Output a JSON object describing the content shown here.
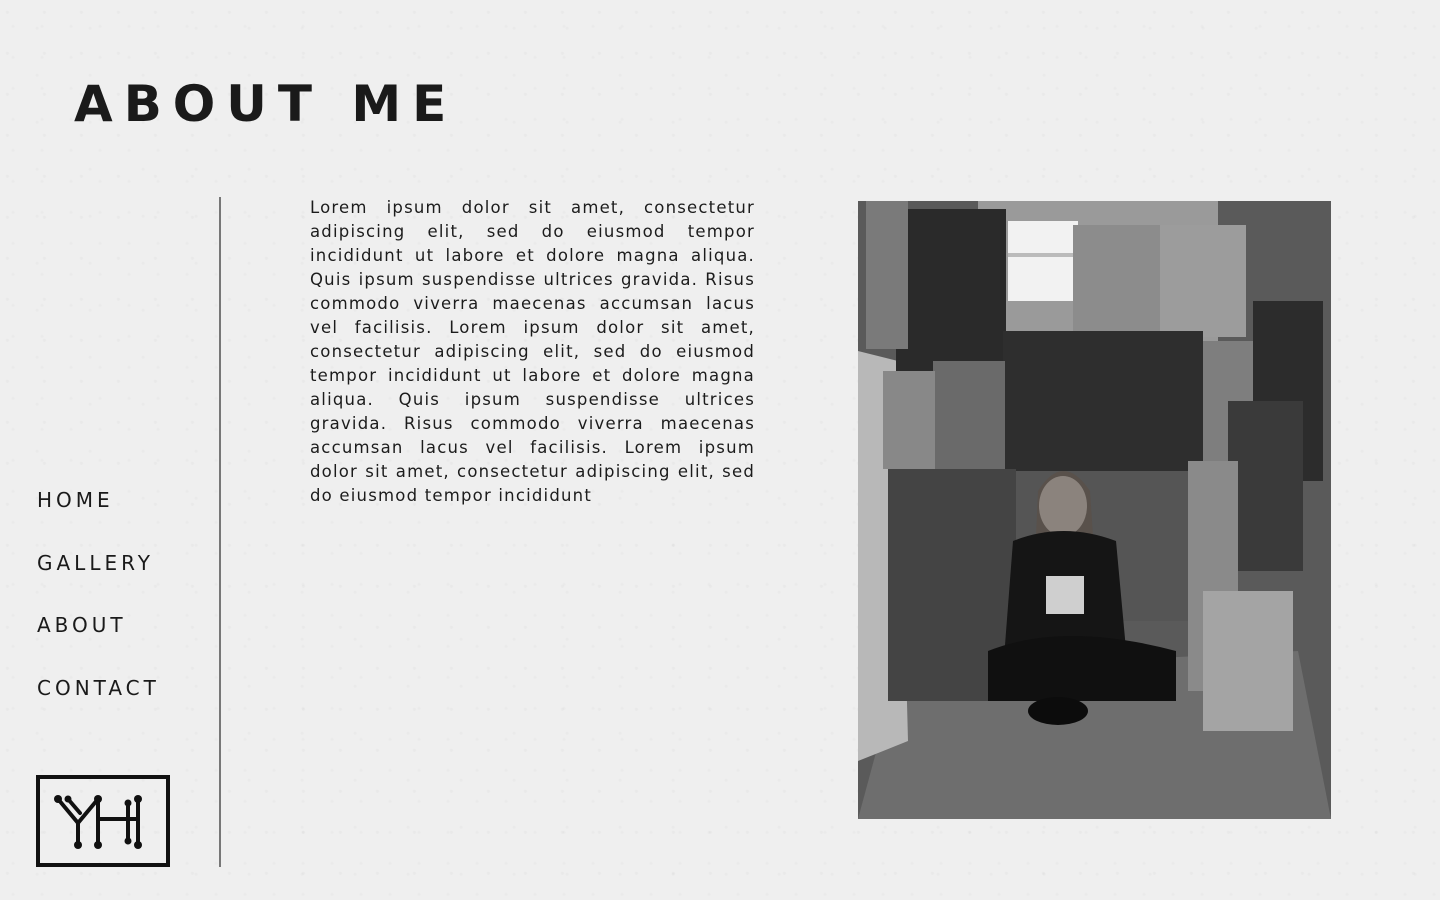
{
  "header": {
    "title": "ABOUT ME"
  },
  "nav": {
    "items": [
      {
        "label": "HOME"
      },
      {
        "label": "GALLERY"
      },
      {
        "label": "ABOUT"
      },
      {
        "label": "CONTACT"
      }
    ]
  },
  "logo": {
    "icon": "yh-monogram-icon",
    "text": "YH"
  },
  "about": {
    "body": "Lorem ipsum dolor sit amet, consectetur adipiscing elit, sed do eiusmod tempor incididunt ut labore et dolore magna aliqua. Quis ipsum suspendisse ultrices gravida. Risus commodo viverra maecenas accumsan lacus vel facilisis. Lorem ipsum dolor sit amet, consectetur adipiscing elit, sed do eiusmod tempor incididunt ut labore et dolore magna aliqua. Quis ipsum suspendisse ultrices gravida. Risus commodo viverra maecenas accumsan lacus vel facilisis. Lorem ipsum dolor sit amet, consectetur adipiscing elit, sed do eiusmod tempor incididunt"
  },
  "photo": {
    "subject": "black-and-white photo of artist seated among paintings"
  },
  "colors": {
    "background": "#efefef",
    "text": "#1a1a1a",
    "divider": "#777777"
  }
}
